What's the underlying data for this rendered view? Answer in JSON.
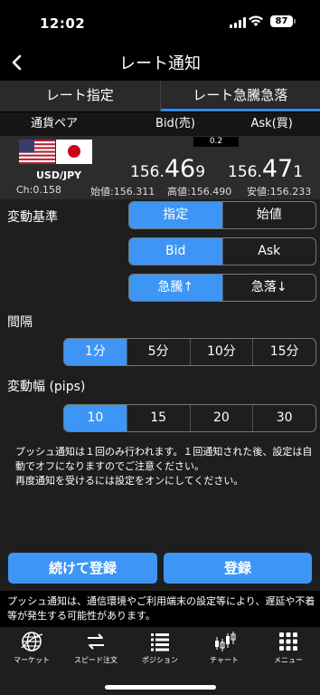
{
  "status": {
    "time": "12:02",
    "battery": "87"
  },
  "nav": {
    "title": "レート通知"
  },
  "tabs": [
    {
      "label": "レート指定",
      "active": false
    },
    {
      "label": "レート急騰急落",
      "active": true
    }
  ],
  "table_header": {
    "pair_col": "通貨ペア",
    "bid_col": "Bid(売)",
    "ask_col": "Ask(買)"
  },
  "rate": {
    "pair": "USD/JPY",
    "change": "Ch:0.158",
    "spread": "0.2",
    "bid": {
      "small": "156.",
      "large": "46",
      "pip": "9"
    },
    "ask": {
      "small": "156.",
      "large": "47",
      "pip": "1"
    },
    "open": "始値:156.311",
    "high": "高値:156.490",
    "low": "安値:156.233"
  },
  "settings": {
    "change_basis_label": "変動基準",
    "basis_options": [
      "指定",
      "始値"
    ],
    "basis_selected": "指定",
    "side_options": [
      "Bid",
      "Ask"
    ],
    "side_selected": "Bid",
    "direction_options": [
      "急騰↑",
      "急落↓"
    ],
    "direction_selected": "急騰↑",
    "interval_label": "間隔",
    "interval_options": [
      "1分",
      "5分",
      "10分",
      "15分"
    ],
    "interval_selected": "1分",
    "range_label": "変動幅 (pips)",
    "range_options": [
      "10",
      "15",
      "20",
      "30"
    ],
    "range_selected": "10",
    "note_line1": "プッシュ通知は１回のみ行われます。１回通知された後、設定は自動でオフになりますのでご注意ください。",
    "note_line2": "再度通知を受けるには設定をオンにしてください。"
  },
  "buttons": {
    "continue_register": "続けて登録",
    "register": "登録"
  },
  "footnote": "プッシュ通知は、通信環境やご利用端末の設定等により、遅延や不着等が発生する可能性があります。",
  "tabbar": [
    {
      "label": "マーケット",
      "icon": "globe-icon"
    },
    {
      "label": "スピード注文",
      "icon": "speed-order-icon"
    },
    {
      "label": "ポジション",
      "icon": "list-icon"
    },
    {
      "label": "チャート",
      "icon": "candlestick-icon"
    },
    {
      "label": "メニュー",
      "icon": "grid-menu-icon"
    }
  ],
  "colors": {
    "accent": "#3d96f5",
    "background": "#000000",
    "panel": "#1e1e1e"
  }
}
